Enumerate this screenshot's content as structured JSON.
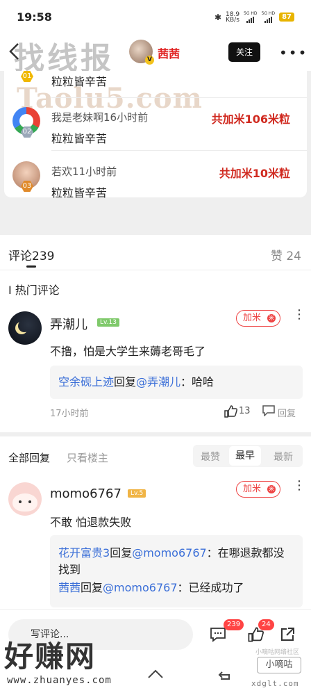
{
  "status": {
    "time": "19:58",
    "net_speed": "18.9",
    "net_unit": "KB/s",
    "sim1": "5G HD",
    "sim2": "5G HD",
    "battery": "87"
  },
  "header": {
    "watermark": "找线报",
    "username": "茜茜",
    "follow_label": "关注"
  },
  "rewards": {
    "watermark": "Taolu5.com",
    "items": [
      {
        "rank": "01",
        "name": "",
        "time": "",
        "text": "粒粒皆辛苦",
        "amount": ""
      },
      {
        "rank": "02",
        "name": "我是老妹啊",
        "time": "16小时前",
        "text": "粒粒皆辛苦",
        "amount": "共加米106米粒"
      },
      {
        "rank": "03",
        "name": "若欢",
        "time": "11小时前",
        "text": "粒粒皆辛苦",
        "amount": "共加米10米粒"
      }
    ]
  },
  "comments": {
    "tab_label": "评论",
    "count": "239",
    "likes_label": "赞",
    "likes_count": "24",
    "hot_title": "I 热门评论",
    "hot": {
      "name": "弄潮儿",
      "level": "Lv.13",
      "add_rice": "加米",
      "text": "不撸，怕是大学生来薅老哥毛了",
      "reply_user": "空余砚上迹",
      "reply_word": "回复",
      "reply_target": "@弄潮儿",
      "reply_text": "：哈哈",
      "time": "17小时前",
      "like_count": "13",
      "reply_label": "回复"
    }
  },
  "replies": {
    "tab_all": "全部回复",
    "tab_owner": "只看楼主",
    "sort": [
      "最赞",
      "最早",
      "最新"
    ],
    "item": {
      "name": "momo6767",
      "level": "Lv.5",
      "add_rice": "加米",
      "text": "不敢 怕退款失败",
      "sub": [
        {
          "user": "花开富贵3",
          "word": "回复",
          "target": "@momo6767",
          "text": "：在哪退款都没找到"
        },
        {
          "user": "茜茜",
          "word": "回复",
          "target": "@momo6767",
          "text": "：已经成功了"
        }
      ]
    }
  },
  "bottom": {
    "input_placeholder": "写评论...",
    "comment_badge": "239",
    "like_badge": "24",
    "watermark": "好赚网",
    "watermark_url": "www.zhuanyes.com",
    "brand_top": "小嘀咕网络社区",
    "brand_name": "小嘀咕",
    "brand_url": "xdglt.com"
  },
  "colors": {
    "accent_red": "#d02a20",
    "link_blue": "#3b6fd8"
  }
}
